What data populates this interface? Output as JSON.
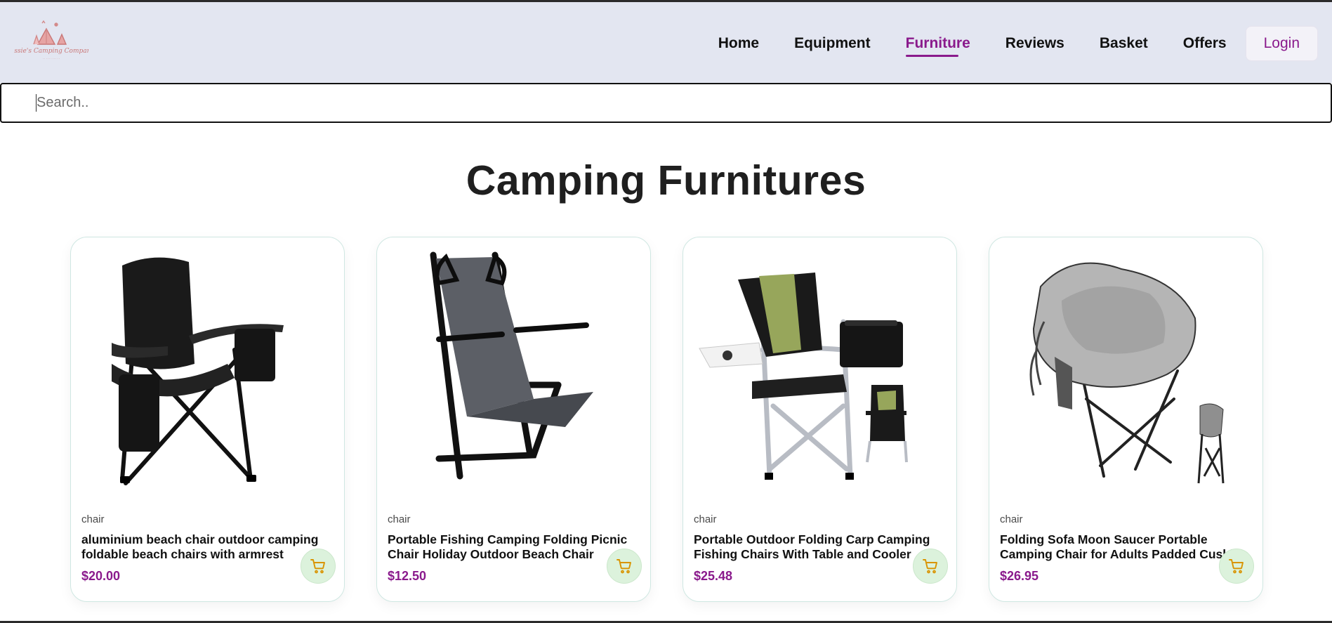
{
  "header": {
    "logo_text": "Jessie's Camping Company",
    "nav": [
      {
        "label": "Home",
        "active": false
      },
      {
        "label": "Equipment",
        "active": false
      },
      {
        "label": "Furniture",
        "active": true
      },
      {
        "label": "Reviews",
        "active": false
      },
      {
        "label": "Basket",
        "active": false
      },
      {
        "label": "Offers",
        "active": false
      }
    ],
    "login_label": "Login"
  },
  "search": {
    "placeholder": "Search..",
    "value": ""
  },
  "main": {
    "title": "Camping Furnitures",
    "products": [
      {
        "category": "chair",
        "name": "aluminium beach chair outdoor camping foldable beach chairs with armrest",
        "price": "$20.00",
        "icon": "cart-icon"
      },
      {
        "category": "chair",
        "name": "Portable Fishing Camping Folding Picnic Chair Holiday Outdoor Beach Chair",
        "price": "$12.50",
        "icon": "cart-icon"
      },
      {
        "category": "chair",
        "name": "Portable Outdoor Folding Carp Camping Fishing Chairs With Table and Cooler",
        "price": "$25.48",
        "icon": "cart-icon"
      },
      {
        "category": "chair",
        "name": "Folding Sofa Moon Saucer Portable Camping Chair for Adults Padded Cushion",
        "price": "$26.95",
        "icon": "cart-icon"
      }
    ]
  },
  "colors": {
    "header_bg": "#e3e6f1",
    "accent": "#8a1a8c",
    "cart_button_bg": "#dcf2dc",
    "cart_icon": "#d99400"
  }
}
